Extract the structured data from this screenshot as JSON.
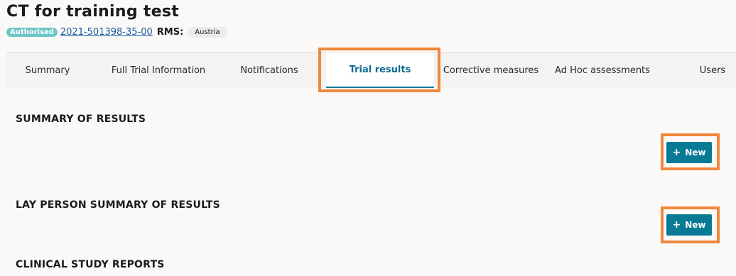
{
  "header": {
    "title": "CT for training test",
    "status_badge": "Authorised",
    "trial_id": "2021-501398-35-00",
    "rms_label": "RMS:",
    "rms_value": "Austria"
  },
  "tabs": [
    {
      "label": "Summary"
    },
    {
      "label": "Full Trial Information"
    },
    {
      "label": "Notifications"
    },
    {
      "label": "Trial results",
      "active": true
    },
    {
      "label": "Corrective measures"
    },
    {
      "label": "Ad Hoc assessments"
    },
    {
      "label": "Users"
    }
  ],
  "sections": {
    "summary_results": {
      "title": "SUMMARY OF RESULTS",
      "button_label": "New"
    },
    "lay_summary": {
      "title": "LAY PERSON SUMMARY OF RESULTS",
      "button_label": "New"
    },
    "csr": {
      "title": "CLINICAL STUDY REPORTS"
    }
  },
  "colors": {
    "accent": "#087a96",
    "highlight": "#f0873a",
    "badge": "#6fc6c6"
  }
}
